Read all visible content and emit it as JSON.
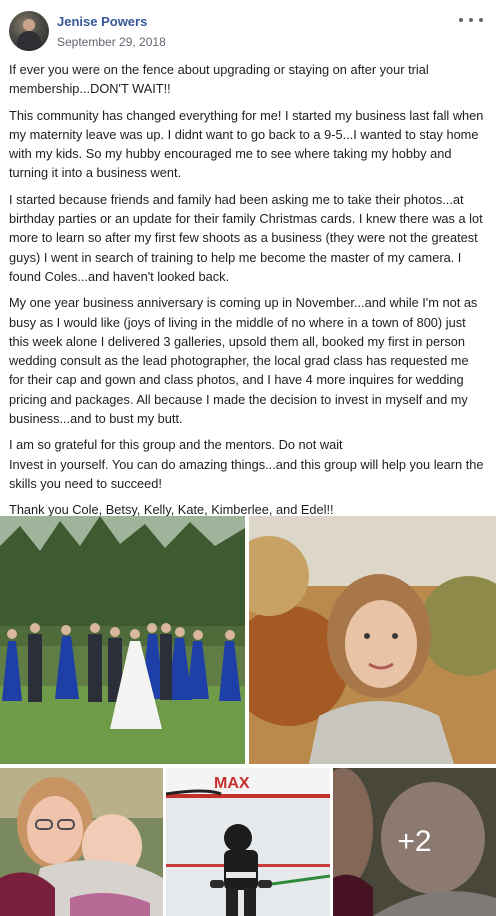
{
  "post": {
    "author": "Jenise Powers",
    "timestamp": "September 29, 2018",
    "menu_icon": "more-horizontal-icon",
    "paragraphs": [
      "If ever you were on the fence about upgrading or staying on after your trial membership...DON'T WAIT!!",
      "This community has changed everything for me! I started my business last fall when my maternity leave was up. I didnt want to go back to a 9-5...I wanted to stay home with my kids. So my hubby encouraged me to see where taking my hobby and turning it into a business went.",
      "I started because friends and family had been asking me to take their photos...at birthday parties or an update for their family Christmas cards. I knew there was a lot more to learn so after my first few shoots as a business (they were not the greatest guys) I went in search of training to help me become the master of my camera. I found Coles...and haven't looked back.",
      "My one year business anniversary is coming up in November...and while I'm not as busy as I would like (joys of living in the middle of no where in a town of 800) just this week alone I delivered 3 galleries, upsold them all, booked my first in person wedding consult as the lead photographer, the local grad class has requested me for their cap and gown and class photos, and I have 4 more inquires for wedding pricing and packages. All because I made the decision to invest in myself and my business...and to bust my butt.",
      "I am so grateful for this group and the mentors. Do not wait",
      "Invest in yourself. You can do amazing things...and this group will help you learn the skills you need to succeed!",
      "Thank you Cole, Betsy, Kelly, Kate, Kimberlee, and Edel!!"
    ],
    "photos": {
      "more_count_label": "+2"
    }
  }
}
